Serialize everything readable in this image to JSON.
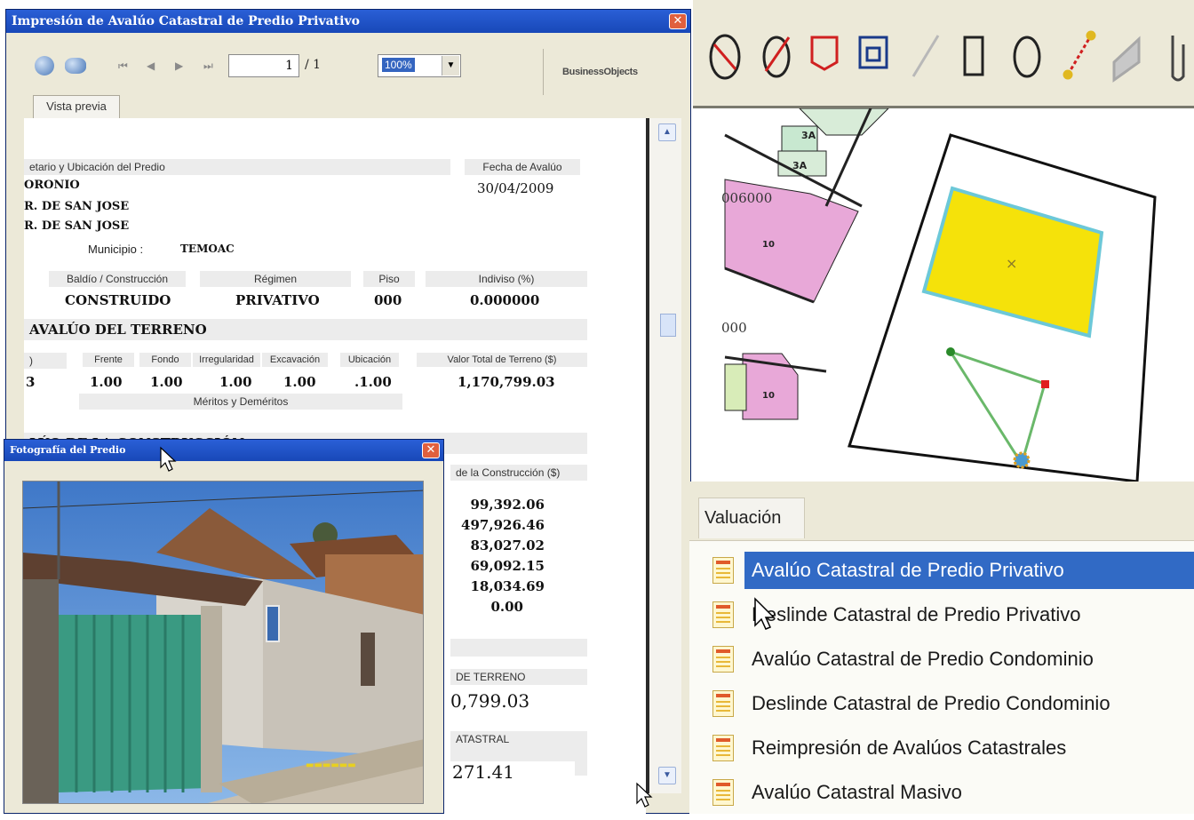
{
  "report_window": {
    "title": "Impresión de Avalúo Catastral de Predio Privativo",
    "close_glyph": "✕",
    "toolbar": {
      "page_current": "1",
      "page_total": "/ 1",
      "zoom_value": "100%",
      "logo_text": "BusinessObjects",
      "nav_first": "⏮",
      "nav_prev": "◀",
      "nav_next": "▶",
      "nav_last": "⏭"
    },
    "preview_tab": "Vista previa",
    "report": {
      "owner_header": "etario y Ubicación del Predio",
      "date_header": "Fecha de Avalúo",
      "date_value": "30/04/2009",
      "owner_line1": "ORONIO",
      "owner_line2": "R. DE SAN JOSE",
      "owner_line3": "R. DE SAN JOSE",
      "municipio_label": "Municipio :",
      "municipio_value": "TEMOAC",
      "col_headers": [
        "Baldío / Construcción",
        "Régimen",
        "Piso",
        "Indiviso (%)"
      ],
      "col_values": [
        "CONSTRUIDO",
        "PRIVATIVO",
        "000",
        "0.000000"
      ],
      "section_terreno": "AVALÚO DEL TERRENO",
      "factor_headers": [
        ")",
        "Frente",
        "Fondo",
        "Irregularidad",
        "Excavación",
        "Ubicación",
        "Valor Total de Terreno ($)"
      ],
      "factor_values": [
        "3",
        "1.00",
        "1.00",
        "1.00",
        "1.00",
        ".1.00",
        "1,170,799.03"
      ],
      "meritos": "Méritos y Deméritos",
      "section_construccion": "LÚO DE LA CONSTRUCCIÓN",
      "construccion_header": "de la Construcción ($)",
      "construccion_values": [
        "99,392.06",
        "497,926.46",
        "83,027.02",
        "69,092.15",
        "18,034.69",
        "0.00"
      ],
      "terreno_total_header": "DE TERRENO",
      "terreno_total_value": "0,799.03",
      "catastral_header": "ATASTRAL",
      "catastral_value": "271.41"
    }
  },
  "photo_window": {
    "title": "Fotografía del Predio",
    "close_glyph": "✕"
  },
  "map": {
    "labels": [
      "3A",
      "3A",
      "006000",
      "10",
      "000",
      "10"
    ]
  },
  "valuacion_menu": {
    "tab_label": "Valuación",
    "items": [
      {
        "label": "Avalúo Catastral de Predio Privativo",
        "selected": true
      },
      {
        "label": "Deslinde Catastral de Predio Privativo",
        "selected": false
      },
      {
        "label": "Avalúo Catastral de Predio Condominio",
        "selected": false
      },
      {
        "label": "Deslinde Catastral de Predio Condominio",
        "selected": false
      },
      {
        "label": "Reimpresión de Avalúos Catastrales",
        "selected": false
      },
      {
        "label": "Avalúo Catastral Masivo",
        "selected": false
      }
    ]
  },
  "colors": {
    "title_bar": "#1848b8",
    "selection": "#316ac5",
    "parcel_fill": "#f5e20a",
    "parcel_border": "#6cc8d8",
    "neighbor_fill": "#e8a8d8"
  }
}
